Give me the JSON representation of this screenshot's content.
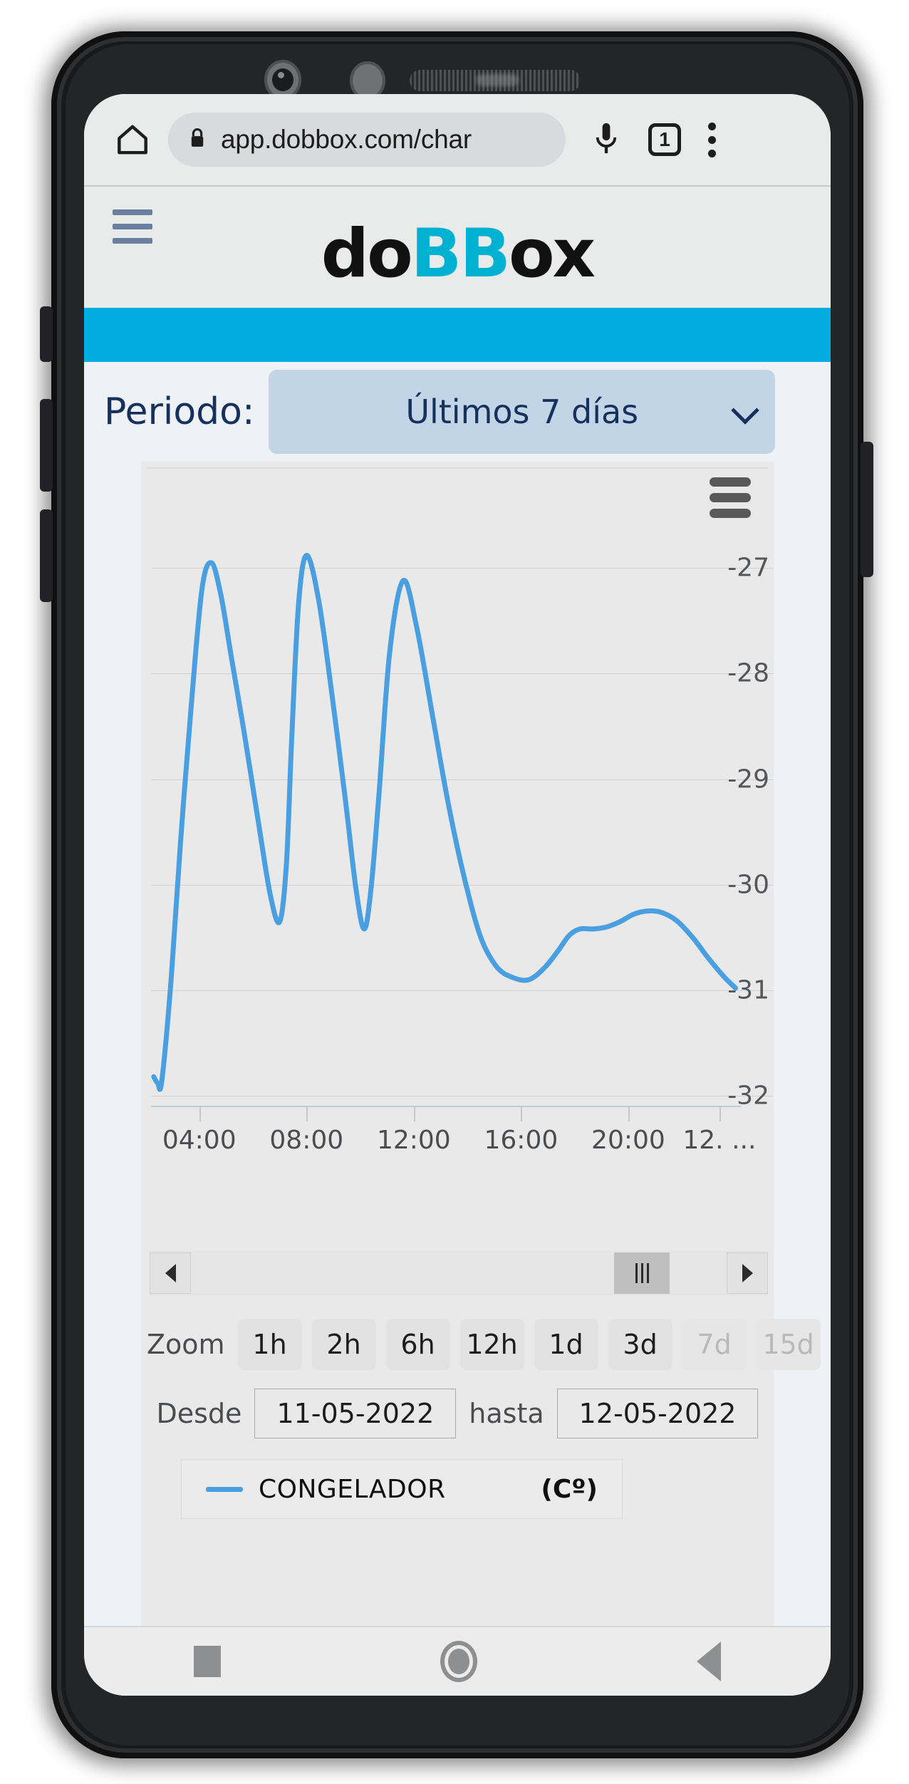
{
  "browser": {
    "home_icon": "home-icon",
    "lock_icon": "lock-icon",
    "url": "app.dobbox.com/char",
    "mic_icon": "microphone-icon",
    "tab_count": "1",
    "menu_icon": "overflow-menu-icon"
  },
  "app_header": {
    "menu_icon": "hamburger-menu-icon",
    "logo_part1": "do",
    "logo_part2": "BB",
    "logo_part3": "ox",
    "logo_cyan": "#00b1d2",
    "band_color": "#00ace0"
  },
  "periodo": {
    "label": "Periodo:",
    "value": "Últimos 7 días",
    "chevron_icon": "chevron-down-icon"
  },
  "chart_controls": {
    "export_icon": "export-menu-icon",
    "scroll_left_icon": "scroll-left-arrow-icon",
    "scroll_right_icon": "scroll-right-arrow-icon",
    "scroll_thumb_icon": "scroll-grip-icon",
    "zoom_label": "Zoom",
    "zoom_buttons": [
      {
        "label": "1h",
        "disabled": false
      },
      {
        "label": "2h",
        "disabled": false
      },
      {
        "label": "6h",
        "disabled": false
      },
      {
        "label": "12h",
        "disabled": false
      },
      {
        "label": "1d",
        "disabled": false
      },
      {
        "label": "3d",
        "disabled": false
      },
      {
        "label": "7d",
        "disabled": true
      },
      {
        "label": "15d",
        "disabled": true
      }
    ],
    "desde_label": "Desde",
    "desde_value": "11-05-2022",
    "hasta_label": "hasta",
    "hasta_value": "12-05-2022"
  },
  "legend": {
    "series_name": "CONGELADOR",
    "unit": "(Cº)",
    "color": "#4a9fe0"
  },
  "nav_bar": {
    "recents_icon": "square-recents-icon",
    "home_icon": "circle-home-icon",
    "back_icon": "triangle-back-icon"
  },
  "chart_data": {
    "type": "line",
    "title": "",
    "xlabel": "",
    "ylabel": "",
    "unit": "Cº",
    "grid": true,
    "legend_position": "bottom-left",
    "ylim": [
      -32,
      -26.6
    ],
    "yticks": [
      -27,
      -28,
      -29,
      -30,
      -31,
      -32
    ],
    "xticks": [
      "04:00",
      "08:00",
      "12:00",
      "16:00",
      "20:00",
      "12. ..."
    ],
    "xtick_positions": [
      4,
      8,
      12,
      16,
      20,
      23.4
    ],
    "xlim": [
      2.2,
      24.2
    ],
    "series": [
      {
        "name": "CONGELADOR",
        "color": "#4a9fe0",
        "x": [
          2.3,
          2.45,
          2.6,
          2.95,
          3.3,
          3.7,
          4.1,
          4.45,
          4.8,
          5.2,
          5.7,
          6.2,
          6.65,
          7.0,
          7.25,
          7.45,
          7.7,
          8.0,
          8.45,
          8.95,
          9.45,
          9.85,
          10.15,
          10.4,
          10.7,
          11.1,
          11.6,
          12.1,
          12.7,
          13.3,
          13.9,
          14.5,
          15.1,
          15.7,
          16.3,
          16.9,
          17.4,
          17.8,
          18.2,
          18.7,
          19.2,
          19.7,
          20.2,
          20.7,
          21.2,
          21.8,
          22.4,
          23.0,
          23.6,
          24.0
        ],
        "y": [
          -31.82,
          -31.88,
          -31.86,
          -30.9,
          -29.6,
          -28.3,
          -27.2,
          -26.95,
          -27.25,
          -27.85,
          -28.6,
          -29.4,
          -30.1,
          -30.35,
          -29.8,
          -28.6,
          -27.35,
          -26.88,
          -27.3,
          -28.2,
          -29.2,
          -30.05,
          -30.42,
          -30.05,
          -29.15,
          -27.8,
          -27.12,
          -27.55,
          -28.4,
          -29.25,
          -29.95,
          -30.5,
          -30.78,
          -30.88,
          -30.9,
          -30.78,
          -30.62,
          -30.48,
          -30.42,
          -30.42,
          -30.4,
          -30.35,
          -30.28,
          -30.25,
          -30.26,
          -30.34,
          -30.5,
          -30.7,
          -30.88,
          -30.98
        ]
      }
    ]
  }
}
